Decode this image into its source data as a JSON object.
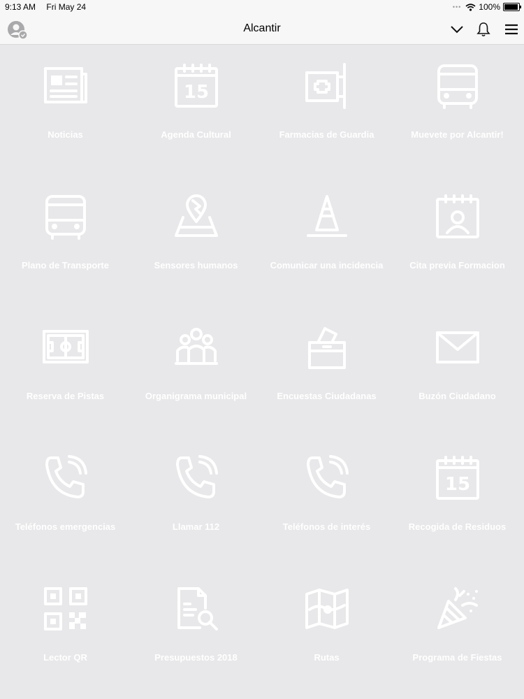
{
  "status_bar": {
    "time": "9:13 AM",
    "date": "Fri May 24",
    "battery": "100%"
  },
  "nav": {
    "title": "Alcantir",
    "icons": [
      "avatar-icon",
      "chevron-down-icon",
      "bell-icon",
      "menu-icon"
    ]
  },
  "colors": {
    "background": "#e8e8ea",
    "bar": "#f7f7f7",
    "tile_content": "#ffffff"
  },
  "tiles": [
    {
      "label": "Noticias",
      "icon": "newspaper-icon"
    },
    {
      "label": "Agenda Cultural",
      "icon": "calendar-icon"
    },
    {
      "label": "Farmacias de Guardia",
      "icon": "pharmacy-sign-icon"
    },
    {
      "label": "Muevete por Alcantir!",
      "icon": "bus-icon"
    },
    {
      "label": "Plano de Transporte",
      "icon": "bus-icon"
    },
    {
      "label": "Sensores humanos",
      "icon": "map-pin-icon"
    },
    {
      "label": "Comunicar una incidencia",
      "icon": "traffic-cone-icon"
    },
    {
      "label": "Cita previa Formacion",
      "icon": "calendar-person-icon"
    },
    {
      "label": "Reserva de Pistas",
      "icon": "sports-field-icon"
    },
    {
      "label": "Organigrama municipal",
      "icon": "people-group-icon"
    },
    {
      "label": "Encuestas Ciudadanas",
      "icon": "ballot-box-icon"
    },
    {
      "label": "Buzón Ciudadano",
      "icon": "envelope-icon"
    },
    {
      "label": "Teléfonos emergencias",
      "icon": "phone-icon"
    },
    {
      "label": "Llamar 112",
      "icon": "phone-icon"
    },
    {
      "label": "Teléfonos de interés",
      "icon": "phone-icon"
    },
    {
      "label": "Recogida de Residuos",
      "icon": "calendar-icon"
    },
    {
      "label": "Lector QR",
      "icon": "qr-code-icon"
    },
    {
      "label": "Presupuestos 2018",
      "icon": "document-search-icon"
    },
    {
      "label": "Rutas",
      "icon": "folded-map-icon"
    },
    {
      "label": "Programa de Fiestas",
      "icon": "party-popper-icon"
    }
  ]
}
